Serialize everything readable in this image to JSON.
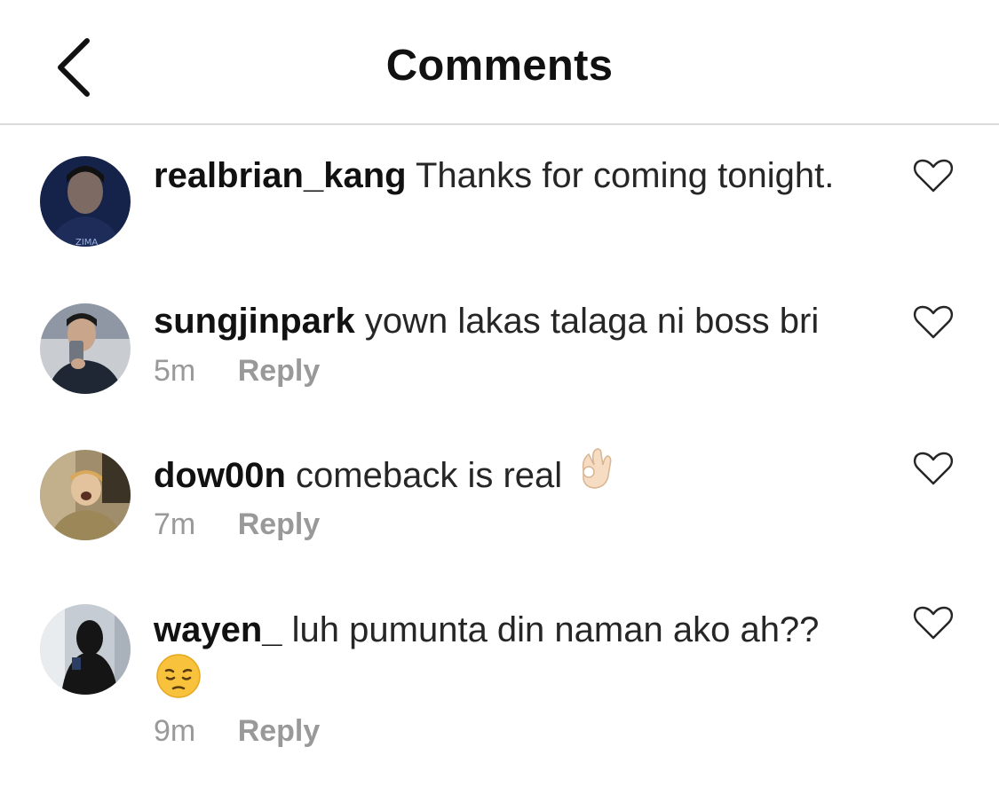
{
  "header": {
    "title": "Comments",
    "back_icon": "chevron-left-icon"
  },
  "comments": [
    {
      "username": "realbrian_kang",
      "text": "Thanks for coming tonight.",
      "time": "",
      "reply_label": "",
      "avatar_color": "#1c2a55"
    },
    {
      "username": "sungjinpark",
      "text": "yown lakas talaga ni boss bri",
      "time": "5m",
      "reply_label": "Reply",
      "avatar_color": "#2a3140"
    },
    {
      "username": "dow00n",
      "text": "comeback is real",
      "emoji": "ok-hand-emoji",
      "time": "7m",
      "reply_label": "Reply",
      "avatar_color": "#8b7b5a"
    },
    {
      "username": "wayen_",
      "text": "luh pumunta din naman ako ah??",
      "emoji": "pensive-face-emoji",
      "time": "9m",
      "reply_label": "Reply",
      "avatar_color": "#b9c0c8"
    }
  ],
  "colors": {
    "text": "#262626",
    "muted": "#999999",
    "divider": "#dbdbdb"
  }
}
